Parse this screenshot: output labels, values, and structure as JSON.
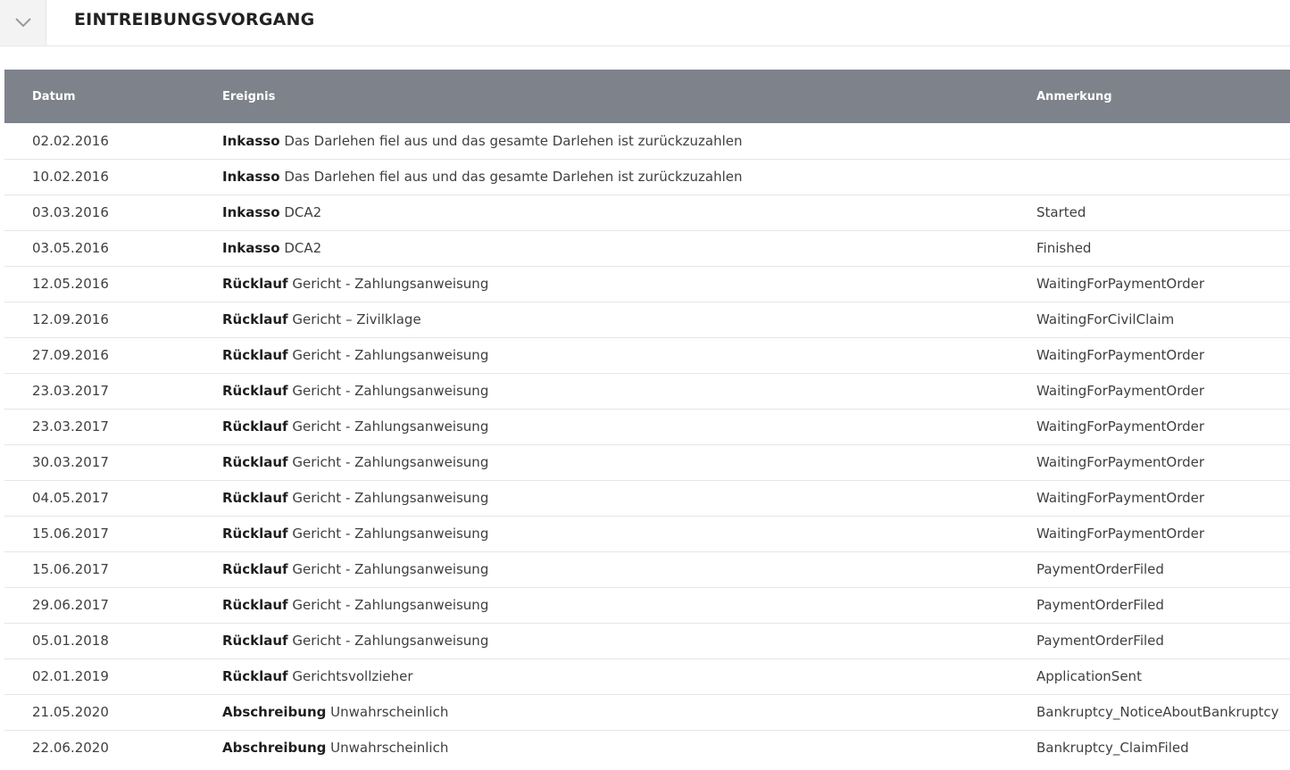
{
  "panel": {
    "title": "EINTREIBUNGSVORGANG"
  },
  "table": {
    "columns": [
      "Datum",
      "Ereignis",
      "Anmerkung"
    ],
    "rows": [
      {
        "date": "02.02.2016",
        "type": "Inkasso",
        "desc": "Das Darlehen fiel aus und das gesamte Darlehen ist zurückzuzahlen",
        "note": ""
      },
      {
        "date": "10.02.2016",
        "type": "Inkasso",
        "desc": "Das Darlehen fiel aus und das gesamte Darlehen ist zurückzuzahlen",
        "note": ""
      },
      {
        "date": "03.03.2016",
        "type": "Inkasso",
        "desc": "DCA2",
        "note": "Started"
      },
      {
        "date": "03.05.2016",
        "type": "Inkasso",
        "desc": "DCA2",
        "note": "Finished"
      },
      {
        "date": "12.05.2016",
        "type": "Rücklauf",
        "desc": "Gericht - Zahlungsanweisung",
        "note": "WaitingForPaymentOrder"
      },
      {
        "date": "12.09.2016",
        "type": "Rücklauf",
        "desc": "Gericht – Zivilklage",
        "note": "WaitingForCivilClaim"
      },
      {
        "date": "27.09.2016",
        "type": "Rücklauf",
        "desc": "Gericht - Zahlungsanweisung",
        "note": "WaitingForPaymentOrder"
      },
      {
        "date": "23.03.2017",
        "type": "Rücklauf",
        "desc": "Gericht - Zahlungsanweisung",
        "note": "WaitingForPaymentOrder"
      },
      {
        "date": "23.03.2017",
        "type": "Rücklauf",
        "desc": "Gericht - Zahlungsanweisung",
        "note": "WaitingForPaymentOrder"
      },
      {
        "date": "30.03.2017",
        "type": "Rücklauf",
        "desc": "Gericht - Zahlungsanweisung",
        "note": "WaitingForPaymentOrder"
      },
      {
        "date": "04.05.2017",
        "type": "Rücklauf",
        "desc": "Gericht - Zahlungsanweisung",
        "note": "WaitingForPaymentOrder"
      },
      {
        "date": "15.06.2017",
        "type": "Rücklauf",
        "desc": "Gericht - Zahlungsanweisung",
        "note": "WaitingForPaymentOrder"
      },
      {
        "date": "15.06.2017",
        "type": "Rücklauf",
        "desc": "Gericht - Zahlungsanweisung",
        "note": "PaymentOrderFiled"
      },
      {
        "date": "29.06.2017",
        "type": "Rücklauf",
        "desc": "Gericht - Zahlungsanweisung",
        "note": "PaymentOrderFiled"
      },
      {
        "date": "05.01.2018",
        "type": "Rücklauf",
        "desc": "Gericht - Zahlungsanweisung",
        "note": "PaymentOrderFiled"
      },
      {
        "date": "02.01.2019",
        "type": "Rücklauf",
        "desc": "Gerichtsvollzieher",
        "note": "ApplicationSent"
      },
      {
        "date": "21.05.2020",
        "type": "Abschreibung",
        "desc": "Unwahrscheinlich",
        "note": "Bankruptcy_NoticeAboutBankruptcy"
      },
      {
        "date": "22.06.2020",
        "type": "Abschreibung",
        "desc": "Unwahrscheinlich",
        "note": "Bankruptcy_ClaimFiled"
      }
    ]
  }
}
